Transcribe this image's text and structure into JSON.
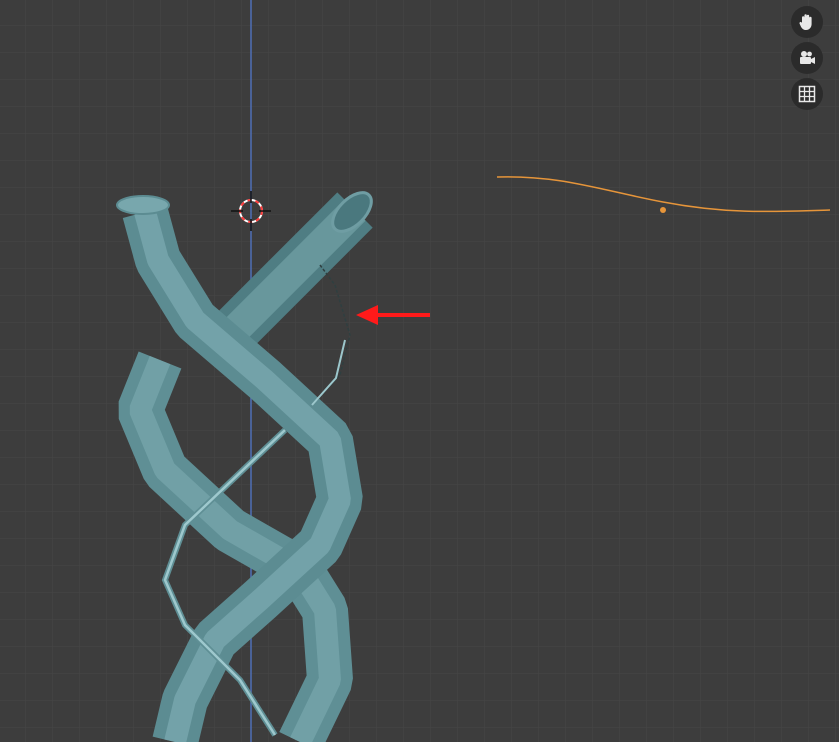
{
  "viewport": {
    "background_color": "#3d3d3d",
    "grid_color": "#4a4a4a",
    "z_axis_color": "#4f6fb7"
  },
  "objects": {
    "tube_color": "#6f9da3",
    "curve_color": "#e6953a",
    "wire_color": "#7fb0b6",
    "annotation_arrow_color": "#ff1a1a"
  },
  "navigation_gizmo": {
    "buttons": [
      {
        "icon": "hand-pan-icon"
      },
      {
        "icon": "camera-view-icon"
      },
      {
        "icon": "orthographic-grid-icon"
      }
    ]
  },
  "cursor_3d": {
    "icon": "3d-cursor-icon",
    "colors": [
      "#ff3b3b",
      "#ffffff"
    ]
  }
}
